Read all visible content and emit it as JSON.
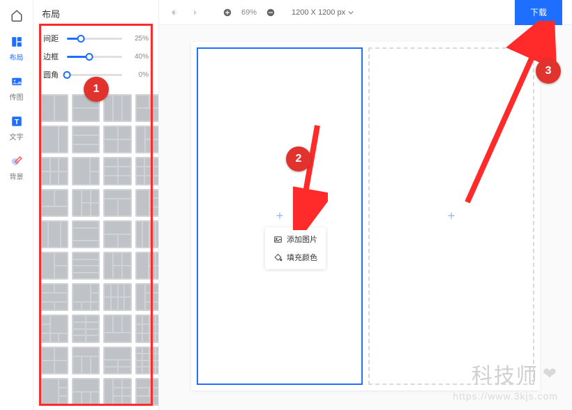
{
  "rail": {
    "items": [
      {
        "name": "home",
        "label": ""
      },
      {
        "name": "layout",
        "label": "布局"
      },
      {
        "name": "image",
        "label": "传图"
      },
      {
        "name": "text",
        "label": "文字"
      },
      {
        "name": "background",
        "label": "背景"
      }
    ]
  },
  "sidebar": {
    "title": "布局",
    "sliders": [
      {
        "label": "间距",
        "value": "25%",
        "pct": 25
      },
      {
        "label": "边框",
        "value": "40%",
        "pct": 40
      },
      {
        "label": "圆角",
        "value": "0%",
        "pct": 0
      }
    ]
  },
  "toolbar": {
    "zoom": "69%",
    "canvasSize": "1200 X 1200 px",
    "download": "下载"
  },
  "contextMenu": {
    "addImage": "添加图片",
    "fillColor": "填充颜色"
  },
  "annotations": {
    "badge1": "1",
    "badge2": "2",
    "badge3": "3"
  },
  "watermark": {
    "title": "科技师",
    "url": "https://www.3kjs.com"
  }
}
